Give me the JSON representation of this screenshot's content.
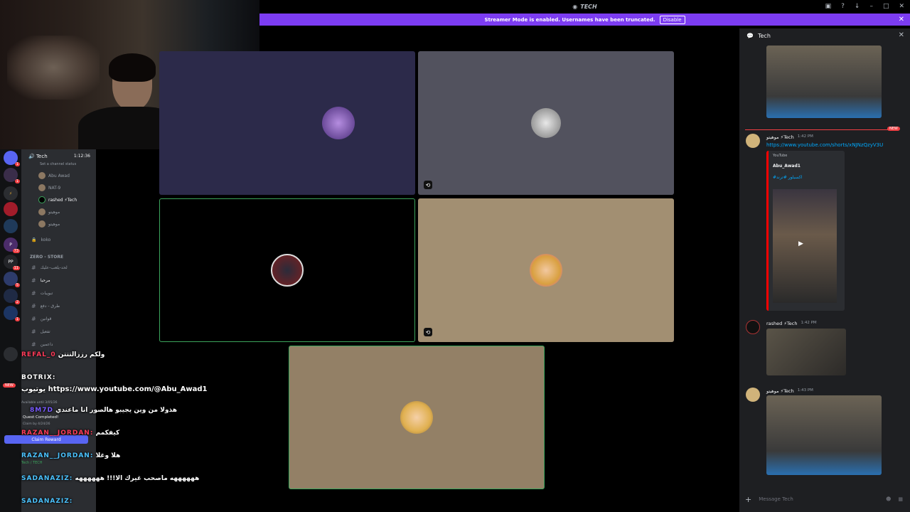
{
  "titlebar": {
    "title": "TECH",
    "icons": [
      "inbox-icon",
      "help-icon",
      "download-icon",
      "minimize-icon",
      "maximize-icon",
      "close-icon"
    ]
  },
  "banner": {
    "text": "Streamer Mode is enabled. Usernames have been truncated.",
    "button": "Disable"
  },
  "sidebar": {
    "voice_channel": "Tech",
    "voice_time": "1:12:36",
    "status": "Set a channel status",
    "members": [
      "Abu Awad",
      "NAT-9",
      "rashed ⚡Tech",
      "موهيتو",
      "موهيتو"
    ],
    "locked_channel": "koko",
    "category": "ZERO - STORE",
    "channels": [
      "لحد-يلعب-عليك",
      "مرحبا",
      "تبويبات",
      "طرق - دفع",
      "قوانين",
      "تفعيل",
      "داعمين"
    ],
    "quest": {
      "available": "Available until 3/05/26",
      "title": "Quest Completed!",
      "claim_by": "Claim by 4/24/26",
      "button": "Claim Reward"
    },
    "user_status": "Tech / TECH"
  },
  "overlay": [
    {
      "name": "REFAL_0",
      "text": "ولكم رززالتتتن"
    },
    {
      "name": "BOTRIX:",
      "text": "يوتيوب https://www.youtube.com/@Abu_Awad1"
    },
    {
      "name": "8M7D",
      "text": "هذولا من وين يجيبو هالصور انا ماعندي"
    },
    {
      "name": "RAZAN__JORDAN:",
      "text": "كيفكمم"
    },
    {
      "name": "RAZAN__JORDAN:",
      "text": "هلا وغلا"
    },
    {
      "name": "SADANAZIZ:",
      "text": "ههههههه ماصحب غيرك الا!!! ههههههه"
    },
    {
      "name": "SADANAZIZ:",
      "text": ""
    }
  ],
  "right_panel": {
    "channel": "Tech",
    "msg1": {
      "author": "موهيتو ⚡Tech",
      "time": "1:42 PM",
      "link": "https://www.youtube.com/shorts/xNJNzQzyV3U",
      "embed_provider": "YouTube",
      "embed_author": "Abu_Awad1",
      "embed_title": "#اكسبلور #ترند"
    },
    "msg2": {
      "author": "rashed ⚡Tech",
      "time": "1:42 PM"
    },
    "msg3": {
      "author": "موهيتو ⚡Tech",
      "time": "1:43 PM"
    },
    "new_label": "NEW",
    "composer_placeholder": "Message Tech"
  },
  "colors": {
    "brand": "#7c3cf2",
    "tile_purple": "#2c2a4a",
    "tile_gray": "#52525e",
    "tile_tan": "#a28f72",
    "tile_tan2": "#938066",
    "speaking": "#3ba55c"
  }
}
